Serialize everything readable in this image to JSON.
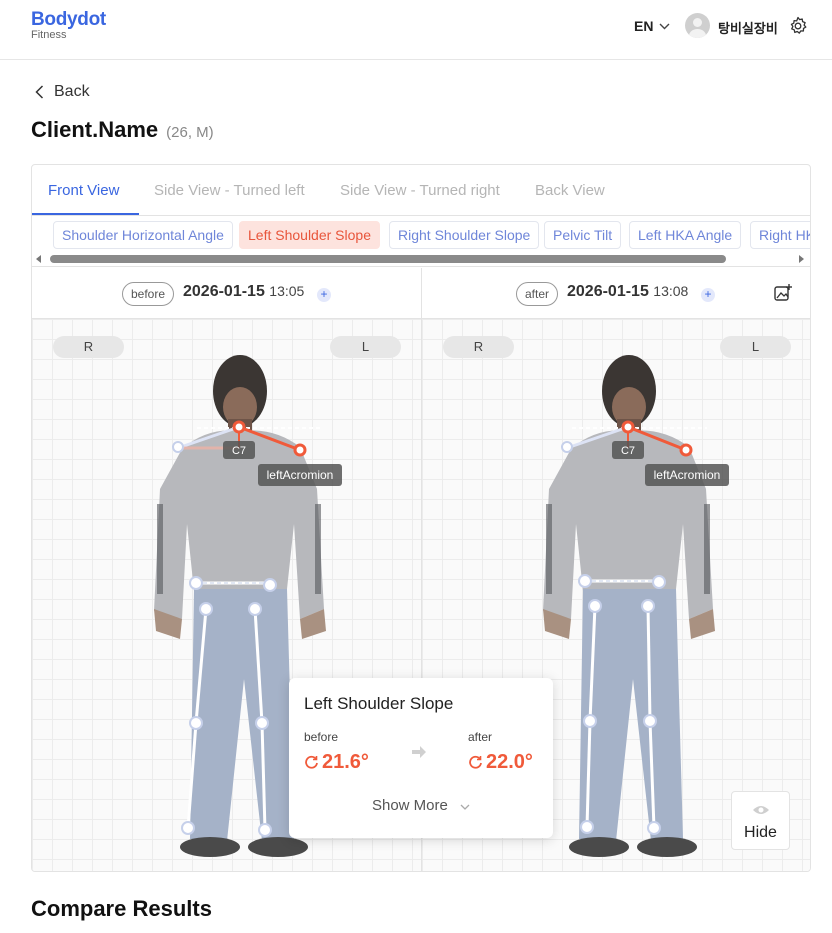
{
  "header": {
    "logo": "Bodydot",
    "logo_sub": "Fitness",
    "language": "EN",
    "username": "탕비실장비"
  },
  "nav": {
    "back_label": "Back"
  },
  "client": {
    "name": "Client.Name",
    "meta": "(26, M)"
  },
  "view_tabs": [
    "Front View",
    "Side View - Turned left",
    "Side View - Turned right",
    "Back View"
  ],
  "metric_chips": [
    "Shoulder Horizontal Angle",
    "Left Shoulder Slope",
    "Right Shoulder Slope",
    "Pelvic Tilt",
    "Left HKA Angle",
    "Right HKA Angle"
  ],
  "active_chip": "Left Shoulder Slope",
  "panels": {
    "before": {
      "tag": "before",
      "date": "2026-01-15",
      "time": "13:05"
    },
    "after": {
      "tag": "after",
      "date": "2026-01-15",
      "time": "13:08"
    }
  },
  "side_labels": {
    "right": "R",
    "left": "L"
  },
  "landmarks": {
    "c7": "C7",
    "acromion": "leftAcromion"
  },
  "popup": {
    "title": "Left Shoulder Slope",
    "before_label": "before",
    "after_label": "after",
    "before_value": "21.6°",
    "after_value": "22.0°",
    "show_more": "Show More"
  },
  "hide_label": "Hide",
  "section_title": "Compare Results",
  "colors": {
    "accent": "#3a66e0",
    "highlight": "#f05a3a",
    "joint": "#c6d0ea"
  }
}
